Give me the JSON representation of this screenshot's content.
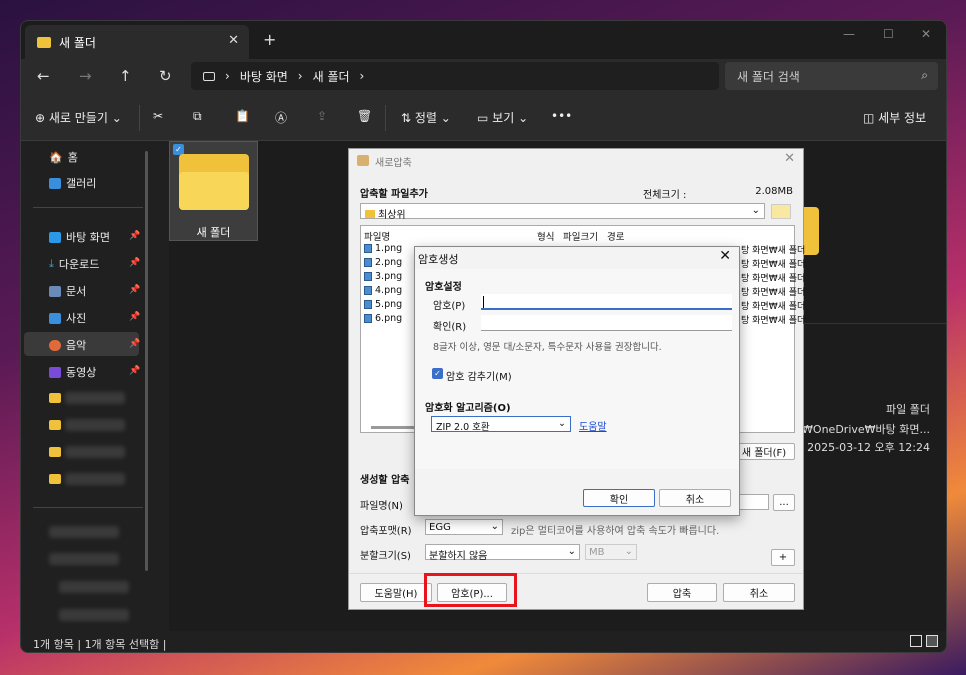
{
  "window": {
    "tab_title": "새 폴더",
    "close": "✕",
    "plus": "+",
    "minimize": "—",
    "maximize": "☐",
    "win_close": "✕"
  },
  "nav": {
    "back": "←",
    "forward": "→",
    "up": "↑",
    "refresh": "↻",
    "path": [
      "바탕 화면",
      "새 폴더"
    ],
    "sep": "›",
    "search_placeholder": "새 폴더 검색"
  },
  "toolbar": {
    "new": "새로 만들기",
    "sort": "정렬",
    "view": "보기",
    "more": "•••",
    "details": "세부 정보"
  },
  "sidebar": {
    "home": "홈",
    "gallery": "갤러리",
    "desktop": "바탕 화면",
    "downloads": "다운로드",
    "documents": "문서",
    "pictures": "사진",
    "music": "음악",
    "videos": "동영상"
  },
  "content": {
    "folder_name": "새 폴더"
  },
  "details": {
    "type": "파일 폴더",
    "path": "iro₩OneDrive₩바탕 화면...",
    "date": "2025-03-12 오후 12:24"
  },
  "status": {
    "left": "1개 항목",
    "right": "1개 항목 선택함"
  },
  "dialog": {
    "title": "새로압축",
    "section_add": "압축할 파일추가",
    "total_size_label": "전체크기 :",
    "total_size": "2.08MB",
    "location": "최상위",
    "cols": [
      "파일명",
      "형식",
      "파일크기",
      "경로"
    ],
    "files": [
      "1.png",
      "2.png",
      "3.png",
      "4.png",
      "5.png",
      "6.png"
    ],
    "path_suffix": "탕 화면₩새 폴더",
    "new_folder": "새 폴더(F)",
    "section_create": "생성할 압축",
    "filename_label": "파일명(N)",
    "format_label": "압축포맷(R)",
    "format_value": "EGG",
    "format_hint": "zip은 멀티코어를 사용하여 압축 속도가 빠릅니다.",
    "split_label": "분할크기(S)",
    "split_value": "분할하지 않음",
    "split_unit": "MB",
    "help_btn": "도움말(H)",
    "password_btn": "암호(P)...",
    "compress_btn": "압축",
    "cancel_btn": "취소",
    "dots": "...",
    "plus": "+"
  },
  "pwdialog": {
    "title": "암호생성",
    "section": "암호설정",
    "pw_label": "암호(P)",
    "confirm_label": "확인(R)",
    "hint": "8글자 이상, 영문 대/소문자, 특수문자 사용을 권장합니다.",
    "hide_label": "암호 감추기(M)",
    "algo_label": "암호화 알고리즘(O)",
    "algo_value": "ZIP 2.0 호환",
    "help_link": "도움말",
    "ok": "확인",
    "cancel": "취소"
  }
}
